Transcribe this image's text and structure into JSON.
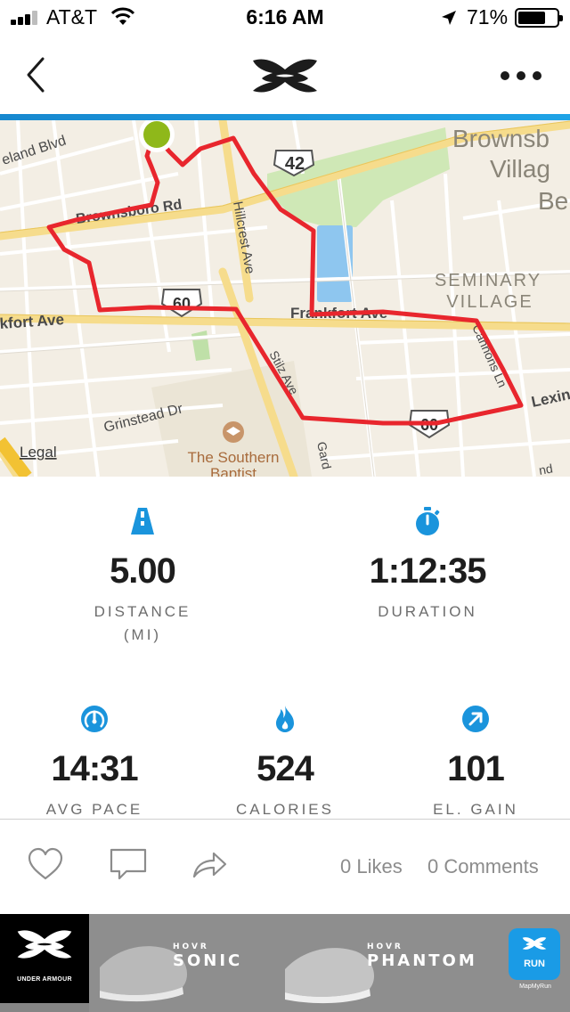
{
  "status_bar": {
    "carrier": "AT&T",
    "time": "6:16 AM",
    "battery": "71%",
    "battery_level": 0.71
  },
  "nav": {
    "back_icon": "chevron-left-icon",
    "logo": "under-armour-logo",
    "more_icon": "more-dots-icon",
    "accent_color": "#1a94dc"
  },
  "map": {
    "labels": {
      "eland_blvd": "eland Blvd",
      "brownsboro_rd": "Brownsboro Rd",
      "hillcrest_ave": "Hillcrest Ave",
      "frankfort_ave_left": "kfort Ave",
      "frankfort_ave_mid": "Frankfort Ave",
      "grinstead_dr": "Grinstead Dr",
      "stilz_ave": "Stilz Ave",
      "gardiner": "Gard",
      "lexington": "Lexin",
      "cannons_ln": "Cannons Ln",
      "brownsboro_village_1": "Brownsb",
      "brownsboro_village_2": "Villag",
      "brownsboro_village_3": "Be",
      "seminary_village_1": "SEMINARY",
      "seminary_village_2": "VILLAGE",
      "southern_baptist_1": "The Southern",
      "southern_baptist_2": "Baptist",
      "legal": "Legal",
      "route_42": "42",
      "route_60_a": "60",
      "route_60_b": "60",
      "route_nd": "nd"
    },
    "route_color": "#e8262d",
    "start_marker_color": "#8fb81a"
  },
  "stats": {
    "distance": {
      "value": "5.00",
      "label": "DISTANCE",
      "unit": "(MI)",
      "icon": "road-icon"
    },
    "duration": {
      "value": "1:12:35",
      "label": "DURATION",
      "icon": "stopwatch-icon"
    },
    "avg_pace": {
      "value": "14:31",
      "label": "AVG PACE",
      "icon": "speedometer-icon"
    },
    "calories": {
      "value": "524",
      "label": "CALORIES",
      "icon": "flame-icon"
    },
    "el_gain": {
      "value": "101",
      "label": "EL. GAIN",
      "icon": "arrow-up-right-icon"
    },
    "icon_color": "#1a94dc"
  },
  "social": {
    "like_icon": "heart-icon",
    "comment_icon": "comment-icon",
    "share_icon": "share-icon",
    "likes": "0 Likes",
    "comments": "0 Comments"
  },
  "ad": {
    "brand": "UNDER ARMOUR",
    "product_1_prefix": "HOVR",
    "product_1_name": "SONIC",
    "product_2_prefix": "HOVR",
    "product_2_name": "PHANTOM",
    "app_label": "RUN",
    "app_sub": "MapMyRun"
  }
}
